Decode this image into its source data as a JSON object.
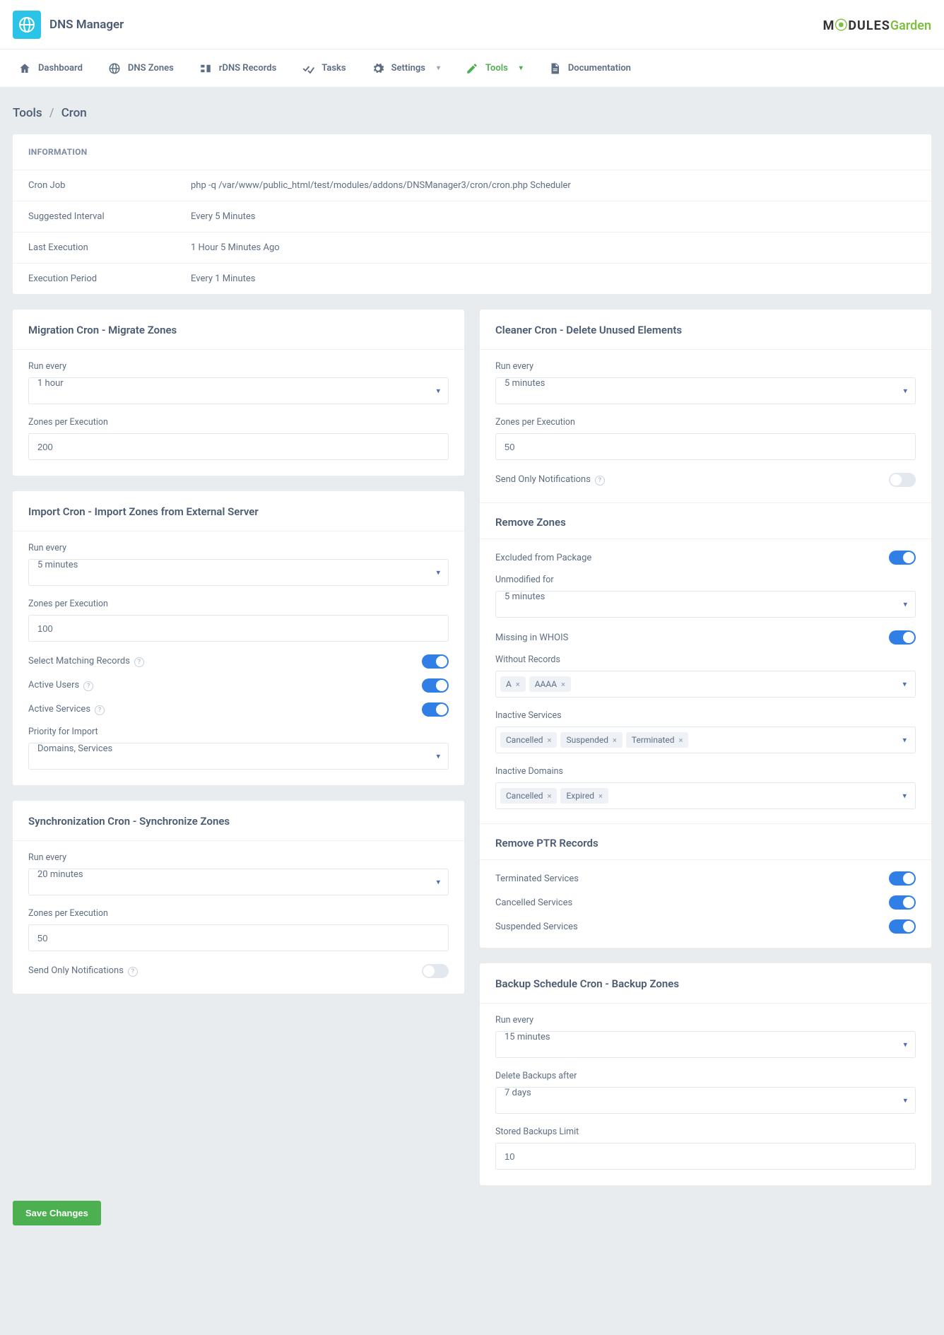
{
  "header": {
    "title": "DNS Manager"
  },
  "nav": {
    "dashboard": "Dashboard",
    "dnszones": "DNS Zones",
    "rdns": "rDNS Records",
    "tasks": "Tasks",
    "settings": "Settings",
    "tools": "Tools",
    "documentation": "Documentation"
  },
  "breadcrumb": {
    "a": "Tools",
    "b": "Cron"
  },
  "info": {
    "title": "INFORMATION",
    "rows": [
      {
        "label": "Cron Job",
        "value": "php -q /var/www/public_html/test/modules/addons/DNSManager3/cron/cron.php Scheduler"
      },
      {
        "label": "Suggested Interval",
        "value": "Every 5 Minutes"
      },
      {
        "label": "Last Execution",
        "value": "1 Hour 5 Minutes Ago"
      },
      {
        "label": "Execution Period",
        "value": "Every 1 Minutes"
      }
    ]
  },
  "migration": {
    "title": "Migration Cron - Migrate Zones",
    "run_label": "Run every",
    "run_value": "1 hour",
    "zpe_label": "Zones per Execution",
    "zpe_value": "200"
  },
  "import": {
    "title": "Import Cron - Import Zones from External Server",
    "run_label": "Run every",
    "run_value": "5 minutes",
    "zpe_label": "Zones per Execution",
    "zpe_value": "100",
    "matching_label": "Select Matching Records",
    "active_users_label": "Active Users",
    "active_services_label": "Active Services",
    "priority_label": "Priority for Import",
    "priority_value": "Domains, Services"
  },
  "sync": {
    "title": "Synchronization Cron - Synchronize Zones",
    "run_label": "Run every",
    "run_value": "20 minutes",
    "zpe_label": "Zones per Execution",
    "zpe_value": "50",
    "notify_label": "Send Only Notifications"
  },
  "cleaner": {
    "title": "Cleaner Cron - Delete Unused Elements",
    "run_label": "Run every",
    "run_value": "5 minutes",
    "zpe_label": "Zones per Execution",
    "zpe_value": "50",
    "notify_label": "Send Only Notifications",
    "remove_zones_title": "Remove Zones",
    "excluded_label": "Excluded from Package",
    "unmodified_label": "Unmodified for",
    "unmodified_value": "5 minutes",
    "whois_label": "Missing in WHOIS",
    "without_records_label": "Without Records",
    "without_records_tags": [
      "A",
      "AAAA"
    ],
    "inactive_services_label": "Inactive Services",
    "inactive_services_tags": [
      "Cancelled",
      "Suspended",
      "Terminated"
    ],
    "inactive_domains_label": "Inactive Domains",
    "inactive_domains_tags": [
      "Cancelled",
      "Expired"
    ],
    "remove_ptr_title": "Remove PTR Records",
    "terminated_label": "Terminated Services",
    "cancelled_label": "Cancelled Services",
    "suspended_label": "Suspended Services"
  },
  "backup": {
    "title": "Backup Schedule Cron - Backup Zones",
    "run_label": "Run every",
    "run_value": "15 minutes",
    "delete_label": "Delete Backups after",
    "delete_value": "7 days",
    "limit_label": "Stored Backups Limit",
    "limit_value": "10"
  },
  "save_label": "Save Changes"
}
